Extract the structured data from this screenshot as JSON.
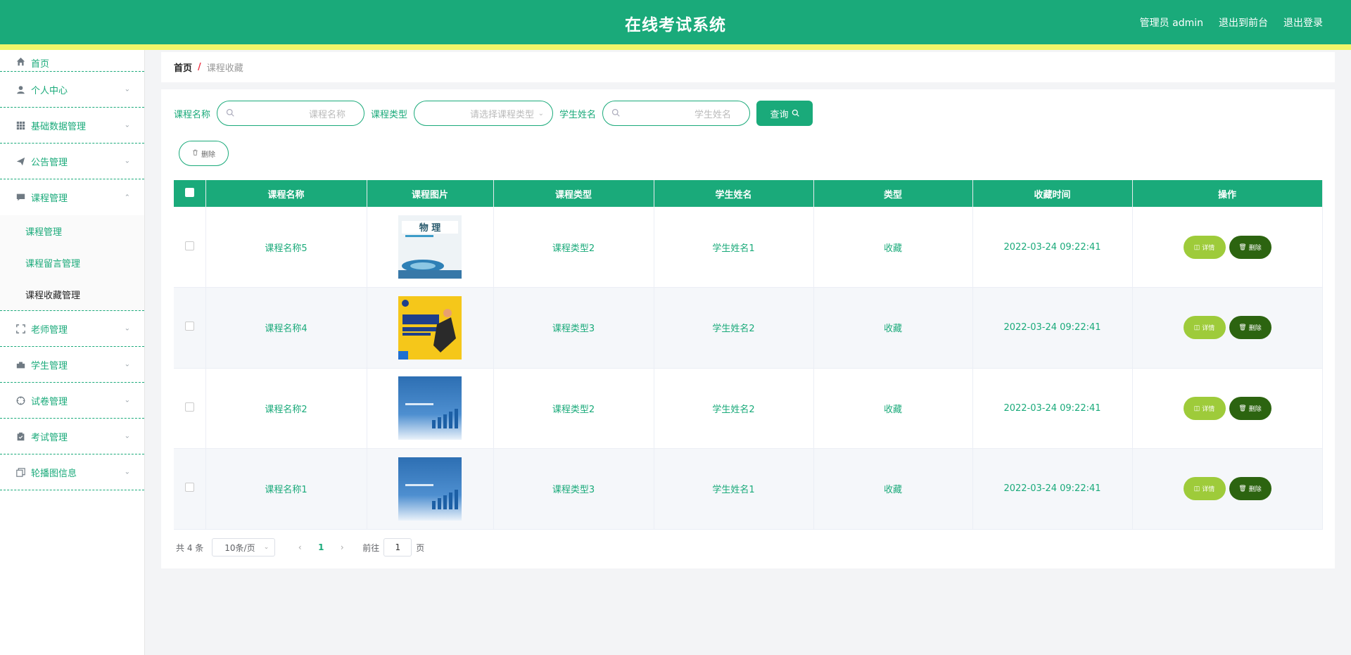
{
  "header": {
    "title": "在线考试系统",
    "user": "管理员 admin",
    "to_front": "退出到前台",
    "logout": "退出登录"
  },
  "sidebar": {
    "items": [
      {
        "label": "首页",
        "icon": "home-icon"
      },
      {
        "label": "个人中心",
        "icon": "user-icon"
      },
      {
        "label": "基础数据管理",
        "icon": "grid-icon"
      },
      {
        "label": "公告管理",
        "icon": "send-icon"
      },
      {
        "label": "课程管理",
        "icon": "chat-icon",
        "expanded": true,
        "children": [
          {
            "label": "课程管理"
          },
          {
            "label": "课程留言管理"
          },
          {
            "label": "课程收藏管理",
            "active": true
          }
        ]
      },
      {
        "label": "老师管理",
        "icon": "fullscreen-icon"
      },
      {
        "label": "学生管理",
        "icon": "suitcase-icon"
      },
      {
        "label": "试卷管理",
        "icon": "aim-icon"
      },
      {
        "label": "考试管理",
        "icon": "clipboard-icon"
      },
      {
        "label": "轮播图信息",
        "icon": "copy-icon"
      }
    ]
  },
  "breadcrumb": {
    "home": "首页",
    "sep": "/",
    "current": "课程收藏"
  },
  "search": {
    "course_name_label": "课程名称",
    "course_name_placeholder": "课程名称",
    "course_type_label": "课程类型",
    "course_type_placeholder": "请选择课程类型",
    "student_name_label": "学生姓名",
    "student_name_placeholder": "学生姓名",
    "query_button": "查询"
  },
  "toolbar": {
    "delete_label": "删除"
  },
  "table": {
    "columns": [
      "课程名称",
      "课程图片",
      "课程类型",
      "学生姓名",
      "类型",
      "收藏时间",
      "操作"
    ],
    "rows": [
      {
        "course_name": "课程名称5",
        "image": "physics-book",
        "course_type": "课程类型2",
        "student_name": "学生姓名1",
        "type": "收藏",
        "time": "2022-03-24 09:22:41"
      },
      {
        "course_name": "课程名称4",
        "image": "math-book",
        "course_type": "课程类型3",
        "student_name": "学生姓名2",
        "type": "收藏",
        "time": "2022-03-24 09:22:41"
      },
      {
        "course_name": "课程名称2",
        "image": "blue-cover",
        "course_type": "课程类型2",
        "student_name": "学生姓名2",
        "type": "收藏",
        "time": "2022-03-24 09:22:41"
      },
      {
        "course_name": "课程名称1",
        "image": "blue-cover",
        "course_type": "课程类型3",
        "student_name": "学生姓名1",
        "type": "收藏",
        "time": "2022-03-24 09:22:41"
      }
    ],
    "detail_label": "详情",
    "delete_label": "删除"
  },
  "pager": {
    "total": "共 4 条",
    "page_size": "10条/页",
    "current_page": "1",
    "goto_prefix": "前往",
    "goto_value": "1",
    "goto_suffix": "页"
  },
  "colors": {
    "primary": "#1aaa7a",
    "accent_strip": "#f0f56a",
    "detail_button": "#9ecb3a",
    "delete_button": "#2c6410"
  }
}
